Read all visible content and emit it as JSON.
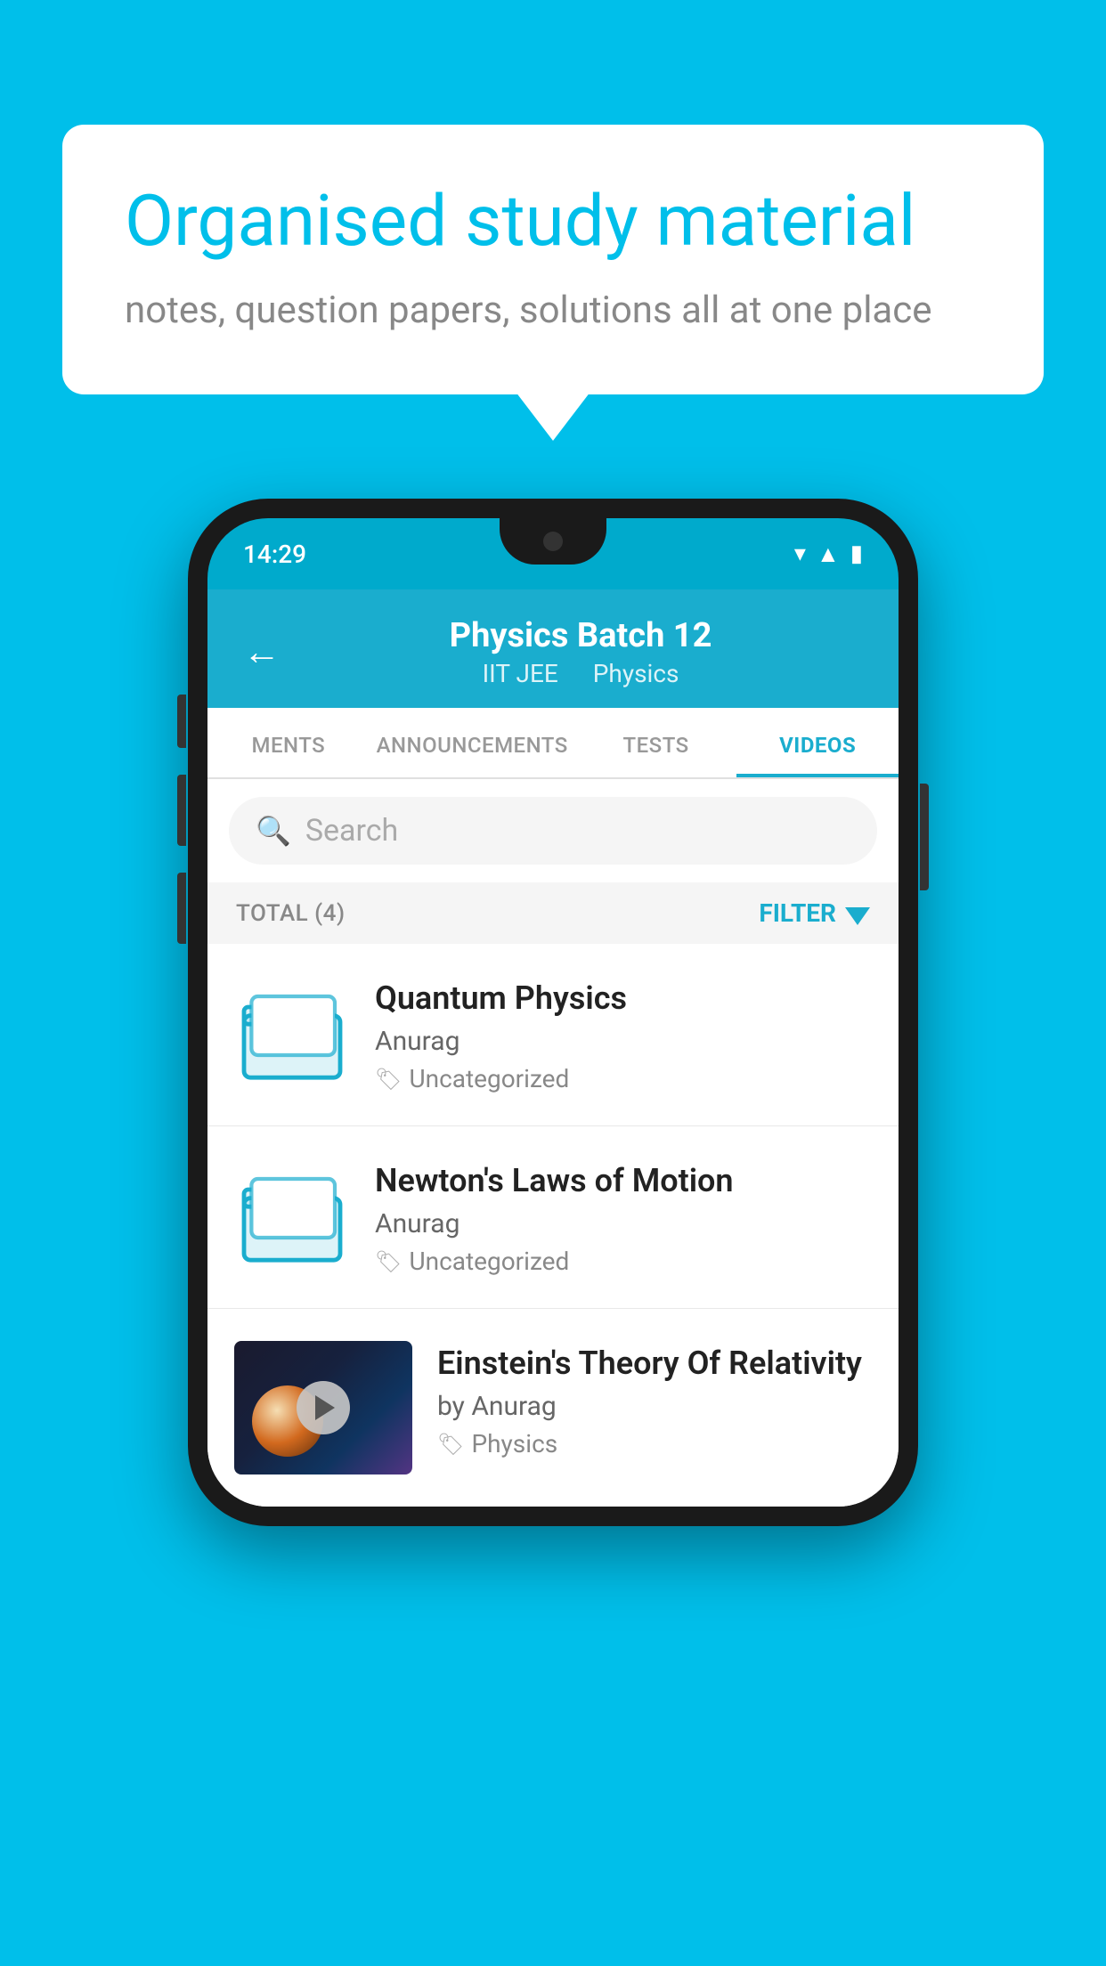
{
  "background_color": "#00BFEA",
  "speech_bubble": {
    "title": "Organised study material",
    "subtitle": "notes, question papers, solutions all at one place"
  },
  "phone": {
    "status_bar": {
      "time": "14:29",
      "icons": [
        "wifi",
        "signal",
        "battery"
      ]
    },
    "header": {
      "back_label": "←",
      "title": "Physics Batch 12",
      "subtitle_part1": "IIT JEE",
      "subtitle_part2": "Physics"
    },
    "tabs": [
      {
        "label": "MENTS",
        "active": false
      },
      {
        "label": "ANNOUNCEMENTS",
        "active": false
      },
      {
        "label": "TESTS",
        "active": false
      },
      {
        "label": "VIDEOS",
        "active": true
      }
    ],
    "search": {
      "placeholder": "Search"
    },
    "filter_row": {
      "total_label": "TOTAL (4)",
      "filter_label": "FILTER"
    },
    "videos": [
      {
        "title": "Quantum Physics",
        "author": "Anurag",
        "tag": "Uncategorized",
        "type": "folder"
      },
      {
        "title": "Newton's Laws of Motion",
        "author": "Anurag",
        "tag": "Uncategorized",
        "type": "folder"
      },
      {
        "title": "Einstein's Theory Of Relativity",
        "author": "by Anurag",
        "tag": "Physics",
        "type": "video"
      }
    ]
  }
}
